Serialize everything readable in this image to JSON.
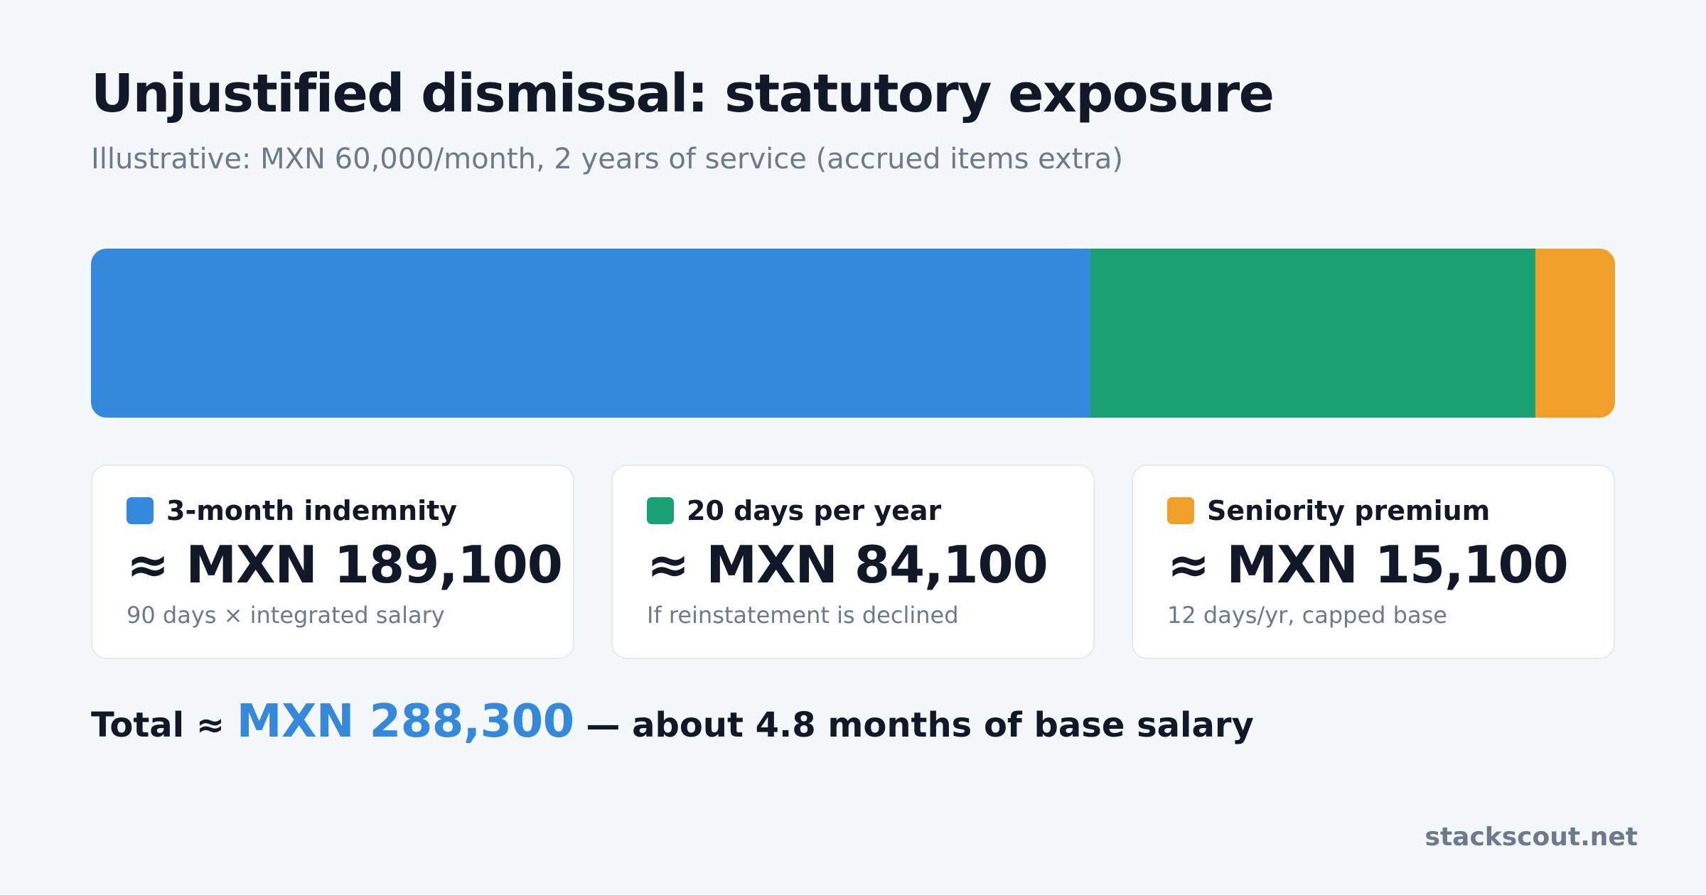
{
  "chart_data": {
    "type": "bar",
    "orientation": "horizontal-stacked",
    "title": "Unjustified dismissal: statutory exposure",
    "subtitle": "Illustrative: MXN 60,000/month, 2 years of service (accrued items extra)",
    "series": [
      {
        "name": "3-month indemnity",
        "value": 189100,
        "display_value": "≈ MXN 189,100",
        "note": "90 days × integrated salary",
        "color": "#3589dc"
      },
      {
        "name": "20 days per year",
        "value": 84100,
        "display_value": "≈ MXN 84,100",
        "note": "If reinstatement is declined",
        "color": "#1ba073"
      },
      {
        "name": "Seniority premium",
        "value": 15100,
        "display_value": "≈ MXN 15,100",
        "note": "12 days/yr, capped base",
        "color": "#f0a02a"
      }
    ],
    "total": {
      "prefix": "Total ≈ ",
      "value": "MXN 288,300",
      "suffix": " — about 4.8 months of base salary"
    }
  },
  "footer": {
    "brand": "stackscout.net"
  }
}
